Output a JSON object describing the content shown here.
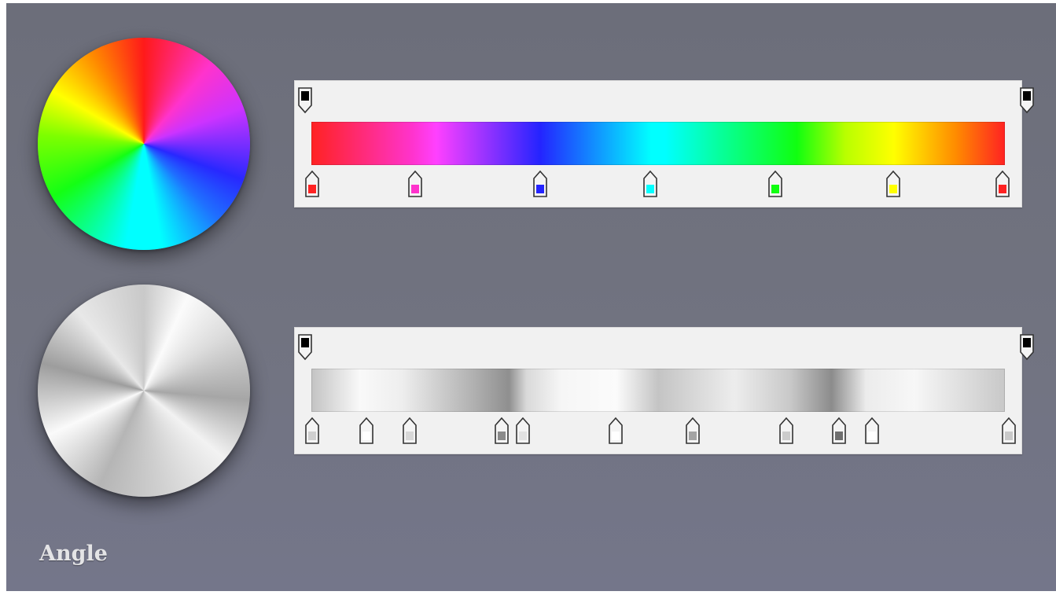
{
  "label": "Angle",
  "colors": {
    "background": "#6f717e",
    "panel": "#f1f1f1",
    "stop_outline": "#333333"
  },
  "color_gradient": {
    "opacity_stops": [
      "#000000",
      "#000000"
    ],
    "color_stops": [
      "#ff2222",
      "#ff33cc",
      "#2424ff",
      "#00ffff",
      "#10ff10",
      "#ffff00",
      "#ff2222"
    ]
  },
  "metal_gradient": {
    "opacity_stops": [
      "#000000",
      "#000000"
    ],
    "color_stops": [
      "#cfcfcf",
      "#ffffff",
      "#d7d7d7",
      "#8a8a8a",
      "#e2e2e2",
      "#ffffff",
      "#a4a4a4",
      "#cccccc",
      "#6f6f6f",
      "#ffffff",
      "#c9c9c9"
    ]
  },
  "icons": {
    "color_wheel": "conic-color-wheel-icon",
    "metal_wheel": "conic-metal-wheel-icon",
    "opacity_stop": "opacity-stop-icon",
    "color_stop": "color-stop-icon"
  }
}
